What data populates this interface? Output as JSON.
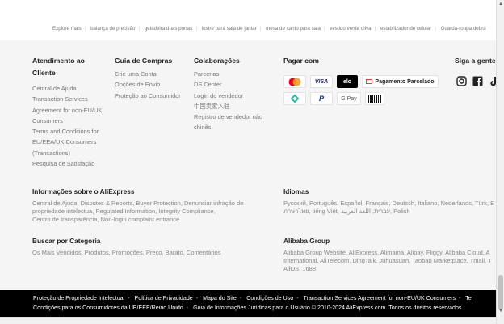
{
  "explore": {
    "items": [
      "Explore mais",
      "balança de precisão",
      "geladeira duas portas",
      "lustre para sala de jantar",
      "mesa de canto para sala",
      "vestido verde oliva",
      "estabilizador de celular",
      "Guarda-roupa dobrá"
    ]
  },
  "atendimento": {
    "title_line1": "Atendimento ao",
    "title_line2": "Cliente",
    "links": [
      "Central de Ajuda",
      "Transaction Services",
      "Agreement for non-EU/UK",
      "Consumers",
      "Terms and Conditions for",
      "EU/EEA/UK Consumers",
      "(Transactions)",
      "Pesquisa de Satisfação"
    ]
  },
  "guia": {
    "title": "Guia de Compras",
    "links": [
      "Crie uma Conta",
      "Opções de Envio",
      "Proteção ao Consumidor"
    ]
  },
  "colaboracoes": {
    "title": "Colaborações",
    "links": [
      "Parcerias",
      "DS Center",
      "Login do vendedor",
      "中国卖家入驻",
      "Registro de vendedor não",
      "chinês"
    ]
  },
  "pagar": {
    "title": "Pagar com",
    "row1": [
      "mastercard",
      "VISA",
      "elo",
      "Pagamento Parcelado"
    ],
    "row2": [
      "pix",
      "PayPal",
      "G Pay",
      "boleto"
    ]
  },
  "siga": {
    "title": "Siga a gente:",
    "icons": [
      "instagram-icon",
      "facebook-icon",
      "tiktok-icon"
    ]
  },
  "informacoes": {
    "title": "Informações sobre o AliExpress",
    "line1": "Central de Ajuda, Disputes & Reports, Buyer Protection, Denunciar infração de",
    "line2": "propriedade intelectua, Regulated Information, Integrity Compliance,",
    "line3": "Centro de transparência, Non-login complaint entrance"
  },
  "idiomas": {
    "title": "Idiomas",
    "line1": "Русский, Português, Español, Français, Deutsch, Italiano, Nederlands, Türk, E",
    "line2": "ภาษาไทย, tiếng Việt, עברית, اللغة العربية, Polish"
  },
  "categoria": {
    "title": "Buscar por Categoria",
    "line1": "Os Mais Vendidos, Produtos, Promoções, Preço, Barato, Comentários"
  },
  "alibaba": {
    "title": "Alibaba Group",
    "line1": "Alibaba Group Website, AliExpress, Alimama, Alipay, Fliggy, Alibaba Cloud, A",
    "line2": "International, AliTelecom, DingTalk, Juhuasuan, Taobao Marketplace, Tmall, T",
    "line3": "AliOS, 1688"
  },
  "bottom": {
    "line1": [
      "Proteção de Propriedade Intelectual",
      "Política de Privacidade",
      "Mapa do Site",
      "Condições de Uso",
      "Transaction Services Agreement for non-EU/UK Consumers",
      "Ter"
    ],
    "line2": [
      "Condições para os Consumidores da UE/EEE/Reino Unido",
      "Guia de Informações Jurídicas para o Usuário"
    ],
    "copyright": "© 2010-2024 AliExpress.com. Todos os direitos reservados."
  },
  "colors": {
    "mastercard_red": "#eb001b",
    "mastercard_orange": "#f79e1b",
    "visa_blue": "#1a1f71",
    "pix_teal": "#32bcad",
    "paypal_blue": "#003087"
  }
}
